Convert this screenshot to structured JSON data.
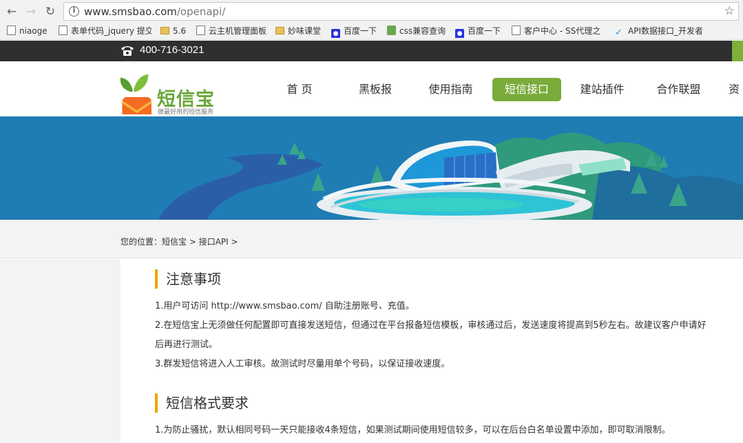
{
  "browser": {
    "url_host": "www.smsbao.com",
    "url_path": "/openapi/",
    "bookmarks": [
      {
        "label": "niaoge",
        "icon": "page-icon"
      },
      {
        "label": "表单代码_jquery 提交",
        "icon": "page-icon"
      },
      {
        "label": "5.6",
        "icon": "folder-icon"
      },
      {
        "label": "云主机管理面板",
        "icon": "page-icon"
      },
      {
        "label": "妙味课堂",
        "icon": "folder-icon"
      },
      {
        "label": "百度一下",
        "icon": "baidu-paw-icon"
      },
      {
        "label": "css兼容查询",
        "icon": "css-icon"
      },
      {
        "label": "百度一下",
        "icon": "baidu-paw-icon"
      },
      {
        "label": "客户中心 - SS代理之",
        "icon": "page-icon"
      },
      {
        "label": "API数据接口_开发者",
        "icon": "api-check-icon"
      }
    ]
  },
  "topbar": {
    "phone": "400-716-3021"
  },
  "header": {
    "logo_title": "短信宝",
    "logo_sub": "做最好用的短信服务",
    "menu": [
      {
        "label": "首 页"
      },
      {
        "label": "黑板报"
      },
      {
        "label": "使用指南"
      },
      {
        "label": "短信接口",
        "active": true
      },
      {
        "label": "建站插件"
      },
      {
        "label": "合作联盟"
      },
      {
        "label": "资"
      }
    ]
  },
  "breadcrumb": {
    "prefix": "您的位置：",
    "items": [
      "短信宝",
      "接口API"
    ],
    "sep": " > "
  },
  "sections": [
    {
      "title": "注意事项",
      "lines": [
        "1.用户可访问 http://www.smsbao.com/ 自助注册账号、充值。",
        "2.在短信宝上无须做任何配置即可直接发送短信，但通过在平台报备短信模板，审核通过后，发送速度将提高到5秒左右。故建议客户申请好",
        "后再进行测试。",
        "3.群发短信将进入人工审核。故测试时尽量用单个号码，以保证接收速度。"
      ]
    },
    {
      "title": "短信格式要求",
      "lines": [
        "1.为防止骚扰，默认相同号码一天只能接收4条短信，如果测试期间使用短信较多，可以在后台白名单设置中添加，即可取消限制。"
      ]
    }
  ],
  "colors": {
    "accent_green": "#7aab3b",
    "section_bar": "#f0a400",
    "topbar_bg": "#2f2f2f",
    "banner_blue": "#1f7db4"
  }
}
